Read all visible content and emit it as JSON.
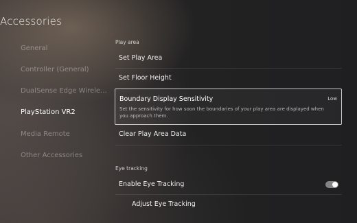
{
  "header": {
    "title": "Accessories"
  },
  "sidebar": {
    "items": [
      {
        "label": "General"
      },
      {
        "label": "Controller (General)"
      },
      {
        "label": "DualSense Edge Wirele..."
      },
      {
        "label": "PlayStation VR2"
      },
      {
        "label": "Media Remote"
      },
      {
        "label": "Other Accessories"
      }
    ],
    "selected": "PlayStation VR2"
  },
  "main": {
    "play_area": {
      "section_label": "Play area",
      "set_play_area": "Set Play Area",
      "set_floor_height": "Set Floor Height",
      "boundary": {
        "title": "Boundary Display Sensitivity",
        "value": "Low",
        "description": "Set the sensitivity for how soon the boundaries of your play area are displayed when you approach them."
      },
      "clear_play_area_data": "Clear Play Area Data"
    },
    "eye_tracking": {
      "section_label": "Eye tracking",
      "enable_eye_tracking": "Enable Eye Tracking",
      "enable_eye_tracking_state": "on",
      "adjust_eye_tracking": "Adjust Eye Tracking"
    }
  }
}
